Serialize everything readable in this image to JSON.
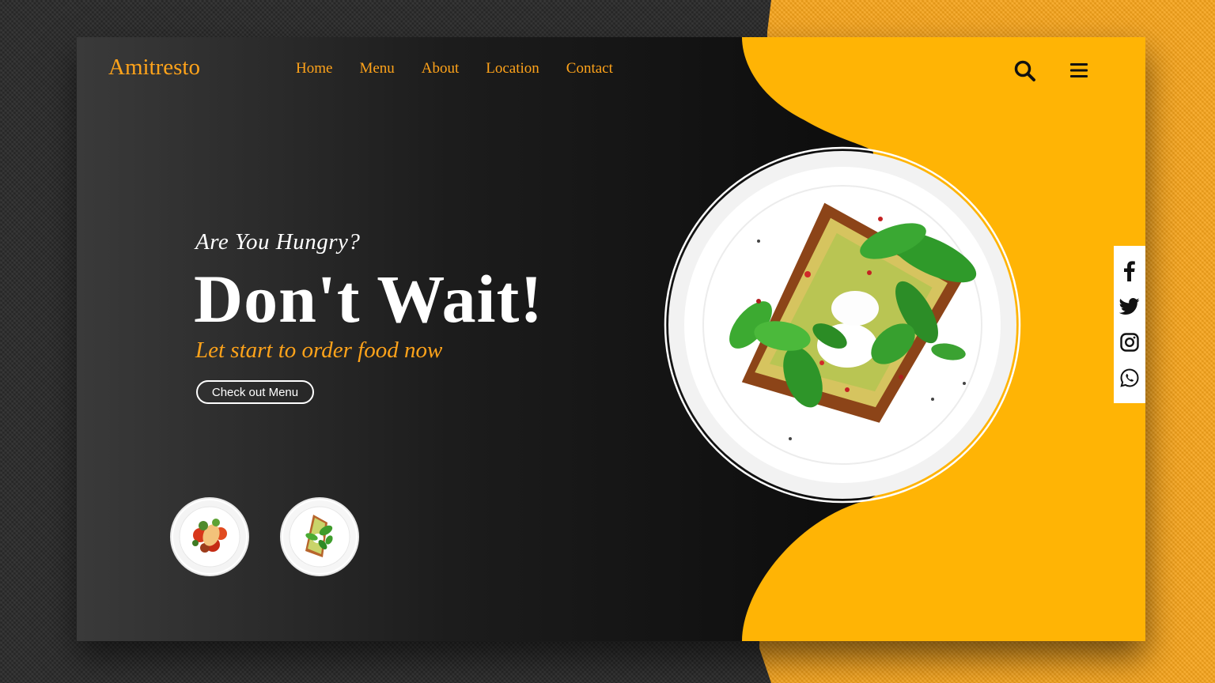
{
  "brand": {
    "logo": "Amitresto"
  },
  "nav": {
    "items": [
      {
        "label": "Home"
      },
      {
        "label": "Menu"
      },
      {
        "label": "About"
      },
      {
        "label": "Location"
      },
      {
        "label": "Contact"
      }
    ]
  },
  "hero": {
    "tagline": "Are You Hungry?",
    "headline": "Don't Wait!",
    "subline": "Let start to order food now",
    "cta_label": "Check out Menu"
  },
  "icons": {
    "search": "search-icon",
    "menu": "hamburger-menu-icon",
    "social": [
      "facebook-icon",
      "twitter-icon",
      "instagram-icon",
      "whatsapp-icon"
    ]
  },
  "colors": {
    "accent": "#ffa31a",
    "panel_yellow": "#ffb405",
    "dark": "#111111",
    "text_light": "#ffffff"
  }
}
